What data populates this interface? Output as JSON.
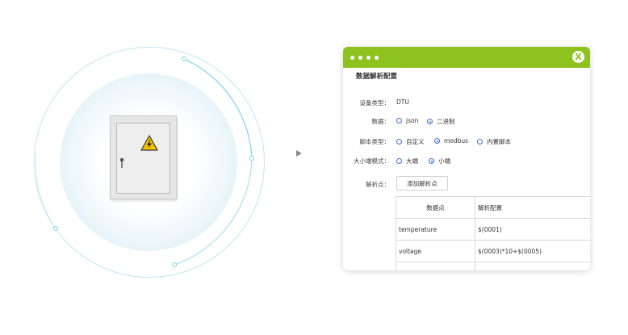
{
  "dialog": {
    "title": "数据解析配置",
    "close_glyph": "X",
    "fields": {
      "device_type": {
        "label": "设备类型：",
        "value": "DTU"
      },
      "data": {
        "label": "数据：",
        "options": [
          "json",
          "二进制"
        ],
        "selected": "二进制"
      },
      "script_type": {
        "label": "脚本类型：",
        "options": [
          "自定义",
          "modbus",
          "内置脚本"
        ],
        "selected": "modbus"
      },
      "endian": {
        "label": "大小端模式：",
        "options": [
          "大端",
          "小端"
        ],
        "selected": "小端"
      },
      "parse_points": {
        "label": "解析点：",
        "add_button": "添加解析点"
      }
    },
    "table": {
      "headers": [
        "数据点",
        "解析配置"
      ],
      "rows": [
        [
          "temperature",
          "$(0001)"
        ],
        [
          "voltage",
          "$(0003)*10+$(0005)"
        ],
        [
          "",
          ""
        ]
      ]
    }
  },
  "colors": {
    "accent": "#8dc21f",
    "radio": "#3b6fd6",
    "ring": "#7fd3e8"
  },
  "icons": {
    "cabinet": "electrical-cabinet-icon",
    "warning": "high-voltage-warning-icon",
    "arrow": "arrow-right-icon"
  }
}
